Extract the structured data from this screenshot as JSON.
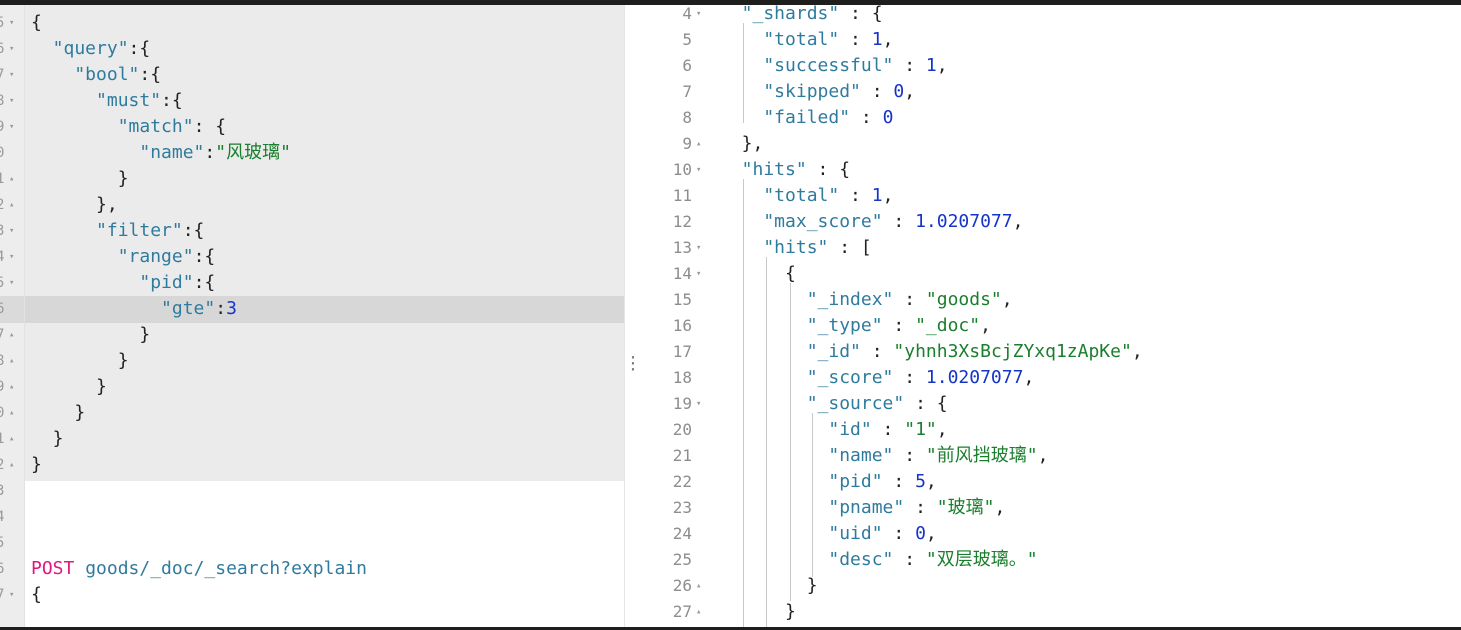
{
  "request_editor": {
    "lines": [
      {
        "num": "5",
        "fold": "▾",
        "tokens": [
          [
            "pun",
            "{"
          ]
        ]
      },
      {
        "num": "6",
        "fold": "▾",
        "tokens": [
          [
            "key",
            "  \"query\""
          ],
          [
            "pun",
            ":{"
          ]
        ]
      },
      {
        "num": "7",
        "fold": "▾",
        "tokens": [
          [
            "key",
            "    \"bool\""
          ],
          [
            "pun",
            ":{"
          ]
        ]
      },
      {
        "num": "8",
        "fold": "▾",
        "tokens": [
          [
            "key",
            "      \"must\""
          ],
          [
            "pun",
            ":{"
          ]
        ]
      },
      {
        "num": "9",
        "fold": "▾",
        "tokens": [
          [
            "key",
            "        \"match\""
          ],
          [
            "pun",
            ": {"
          ]
        ]
      },
      {
        "num": "0",
        "fold": "",
        "tokens": [
          [
            "key",
            "          \"name\""
          ],
          [
            "pun",
            ":"
          ],
          [
            "str",
            "\"风玻璃\""
          ]
        ]
      },
      {
        "num": "1",
        "fold": "▴",
        "tokens": [
          [
            "pun",
            "        }"
          ]
        ]
      },
      {
        "num": "2",
        "fold": "▴",
        "tokens": [
          [
            "pun",
            "      },"
          ]
        ]
      },
      {
        "num": "3",
        "fold": "▾",
        "tokens": [
          [
            "key",
            "      \"filter\""
          ],
          [
            "pun",
            ":{"
          ]
        ]
      },
      {
        "num": "4",
        "fold": "▾",
        "tokens": [
          [
            "key",
            "        \"range\""
          ],
          [
            "pun",
            ":{"
          ]
        ]
      },
      {
        "num": "5",
        "fold": "▾",
        "tokens": [
          [
            "key",
            "          \"pid\""
          ],
          [
            "pun",
            ":{"
          ]
        ]
      },
      {
        "num": "6",
        "fold": "",
        "tokens": [
          [
            "key",
            "            \"gte\""
          ],
          [
            "pun",
            ":"
          ],
          [
            "num",
            "3"
          ]
        ]
      },
      {
        "num": "7",
        "fold": "▴",
        "tokens": [
          [
            "pun",
            "          }"
          ]
        ]
      },
      {
        "num": "8",
        "fold": "▴",
        "tokens": [
          [
            "pun",
            "        }"
          ]
        ]
      },
      {
        "num": "9",
        "fold": "▴",
        "tokens": [
          [
            "pun",
            "      }"
          ]
        ]
      },
      {
        "num": "0",
        "fold": "▴",
        "tokens": [
          [
            "pun",
            "    }"
          ]
        ]
      },
      {
        "num": "1",
        "fold": "▴",
        "tokens": [
          [
            "pun",
            "  }"
          ]
        ]
      },
      {
        "num": "2",
        "fold": "▴",
        "tokens": [
          [
            "pun",
            "}"
          ]
        ]
      },
      {
        "num": "3",
        "fold": "",
        "tokens": []
      },
      {
        "num": "4",
        "fold": "",
        "tokens": []
      },
      {
        "num": "5",
        "fold": "",
        "tokens": []
      },
      {
        "num": "6",
        "fold": "",
        "tokens": [
          [
            "method",
            "POST"
          ],
          [
            "url",
            " goods/_doc/_search?explain"
          ]
        ]
      },
      {
        "num": "7",
        "fold": "▾",
        "tokens": [
          [
            "pun",
            "{"
          ]
        ]
      }
    ]
  },
  "response_viewer": {
    "lines": [
      {
        "num": "4",
        "fold": "▾",
        "tokens": [
          [
            "key",
            "  \"_shards\""
          ],
          [
            "pun",
            " : {"
          ]
        ]
      },
      {
        "num": "5",
        "fold": "",
        "tokens": [
          [
            "key",
            "    \"total\""
          ],
          [
            "pun",
            " : "
          ],
          [
            "num",
            "1"
          ],
          [
            "pun",
            ","
          ]
        ]
      },
      {
        "num": "6",
        "fold": "",
        "tokens": [
          [
            "key",
            "    \"successful\""
          ],
          [
            "pun",
            " : "
          ],
          [
            "num",
            "1"
          ],
          [
            "pun",
            ","
          ]
        ]
      },
      {
        "num": "7",
        "fold": "",
        "tokens": [
          [
            "key",
            "    \"skipped\""
          ],
          [
            "pun",
            " : "
          ],
          [
            "num",
            "0"
          ],
          [
            "pun",
            ","
          ]
        ]
      },
      {
        "num": "8",
        "fold": "",
        "tokens": [
          [
            "key",
            "    \"failed\""
          ],
          [
            "pun",
            " : "
          ],
          [
            "num",
            "0"
          ]
        ]
      },
      {
        "num": "9",
        "fold": "▴",
        "tokens": [
          [
            "pun",
            "  },"
          ]
        ]
      },
      {
        "num": "10",
        "fold": "▾",
        "tokens": [
          [
            "key",
            "  \"hits\""
          ],
          [
            "pun",
            " : {"
          ]
        ]
      },
      {
        "num": "11",
        "fold": "",
        "tokens": [
          [
            "key",
            "    \"total\""
          ],
          [
            "pun",
            " : "
          ],
          [
            "num",
            "1"
          ],
          [
            "pun",
            ","
          ]
        ]
      },
      {
        "num": "12",
        "fold": "",
        "tokens": [
          [
            "key",
            "    \"max_score\""
          ],
          [
            "pun",
            " : "
          ],
          [
            "num",
            "1.0207077"
          ],
          [
            "pun",
            ","
          ]
        ]
      },
      {
        "num": "13",
        "fold": "▾",
        "tokens": [
          [
            "key",
            "    \"hits\""
          ],
          [
            "pun",
            " : ["
          ]
        ]
      },
      {
        "num": "14",
        "fold": "▾",
        "tokens": [
          [
            "pun",
            "      {"
          ]
        ]
      },
      {
        "num": "15",
        "fold": "",
        "tokens": [
          [
            "key",
            "        \"_index\""
          ],
          [
            "pun",
            " : "
          ],
          [
            "str",
            "\"goods\""
          ],
          [
            "pun",
            ","
          ]
        ]
      },
      {
        "num": "16",
        "fold": "",
        "tokens": [
          [
            "key",
            "        \"_type\""
          ],
          [
            "pun",
            " : "
          ],
          [
            "str",
            "\"_doc\""
          ],
          [
            "pun",
            ","
          ]
        ]
      },
      {
        "num": "17",
        "fold": "",
        "tokens": [
          [
            "key",
            "        \"_id\""
          ],
          [
            "pun",
            " : "
          ],
          [
            "str",
            "\"yhnh3XsBcjZYxq1zApKe\""
          ],
          [
            "pun",
            ","
          ]
        ]
      },
      {
        "num": "18",
        "fold": "",
        "tokens": [
          [
            "key",
            "        \"_score\""
          ],
          [
            "pun",
            " : "
          ],
          [
            "num",
            "1.0207077"
          ],
          [
            "pun",
            ","
          ]
        ]
      },
      {
        "num": "19",
        "fold": "▾",
        "tokens": [
          [
            "key",
            "        \"_source\""
          ],
          [
            "pun",
            " : {"
          ]
        ]
      },
      {
        "num": "20",
        "fold": "",
        "tokens": [
          [
            "key",
            "          \"id\""
          ],
          [
            "pun",
            " : "
          ],
          [
            "str",
            "\"1\""
          ],
          [
            "pun",
            ","
          ]
        ]
      },
      {
        "num": "21",
        "fold": "",
        "tokens": [
          [
            "key",
            "          \"name\""
          ],
          [
            "pun",
            " : "
          ],
          [
            "str",
            "\"前风挡玻璃\""
          ],
          [
            "pun",
            ","
          ]
        ]
      },
      {
        "num": "22",
        "fold": "",
        "tokens": [
          [
            "key",
            "          \"pid\""
          ],
          [
            "pun",
            " : "
          ],
          [
            "num",
            "5"
          ],
          [
            "pun",
            ","
          ]
        ]
      },
      {
        "num": "23",
        "fold": "",
        "tokens": [
          [
            "key",
            "          \"pname\""
          ],
          [
            "pun",
            " : "
          ],
          [
            "str",
            "\"玻璃\""
          ],
          [
            "pun",
            ","
          ]
        ]
      },
      {
        "num": "24",
        "fold": "",
        "tokens": [
          [
            "key",
            "          \"uid\""
          ],
          [
            "pun",
            " : "
          ],
          [
            "num",
            "0"
          ],
          [
            "pun",
            ","
          ]
        ]
      },
      {
        "num": "25",
        "fold": "",
        "tokens": [
          [
            "key",
            "          \"desc\""
          ],
          [
            "pun",
            " : "
          ],
          [
            "str",
            "\"双层玻璃。\""
          ]
        ]
      },
      {
        "num": "26",
        "fold": "▴",
        "tokens": [
          [
            "pun",
            "        }"
          ]
        ]
      },
      {
        "num": "27",
        "fold": "▴",
        "tokens": [
          [
            "pun",
            "      }"
          ]
        ]
      }
    ]
  }
}
